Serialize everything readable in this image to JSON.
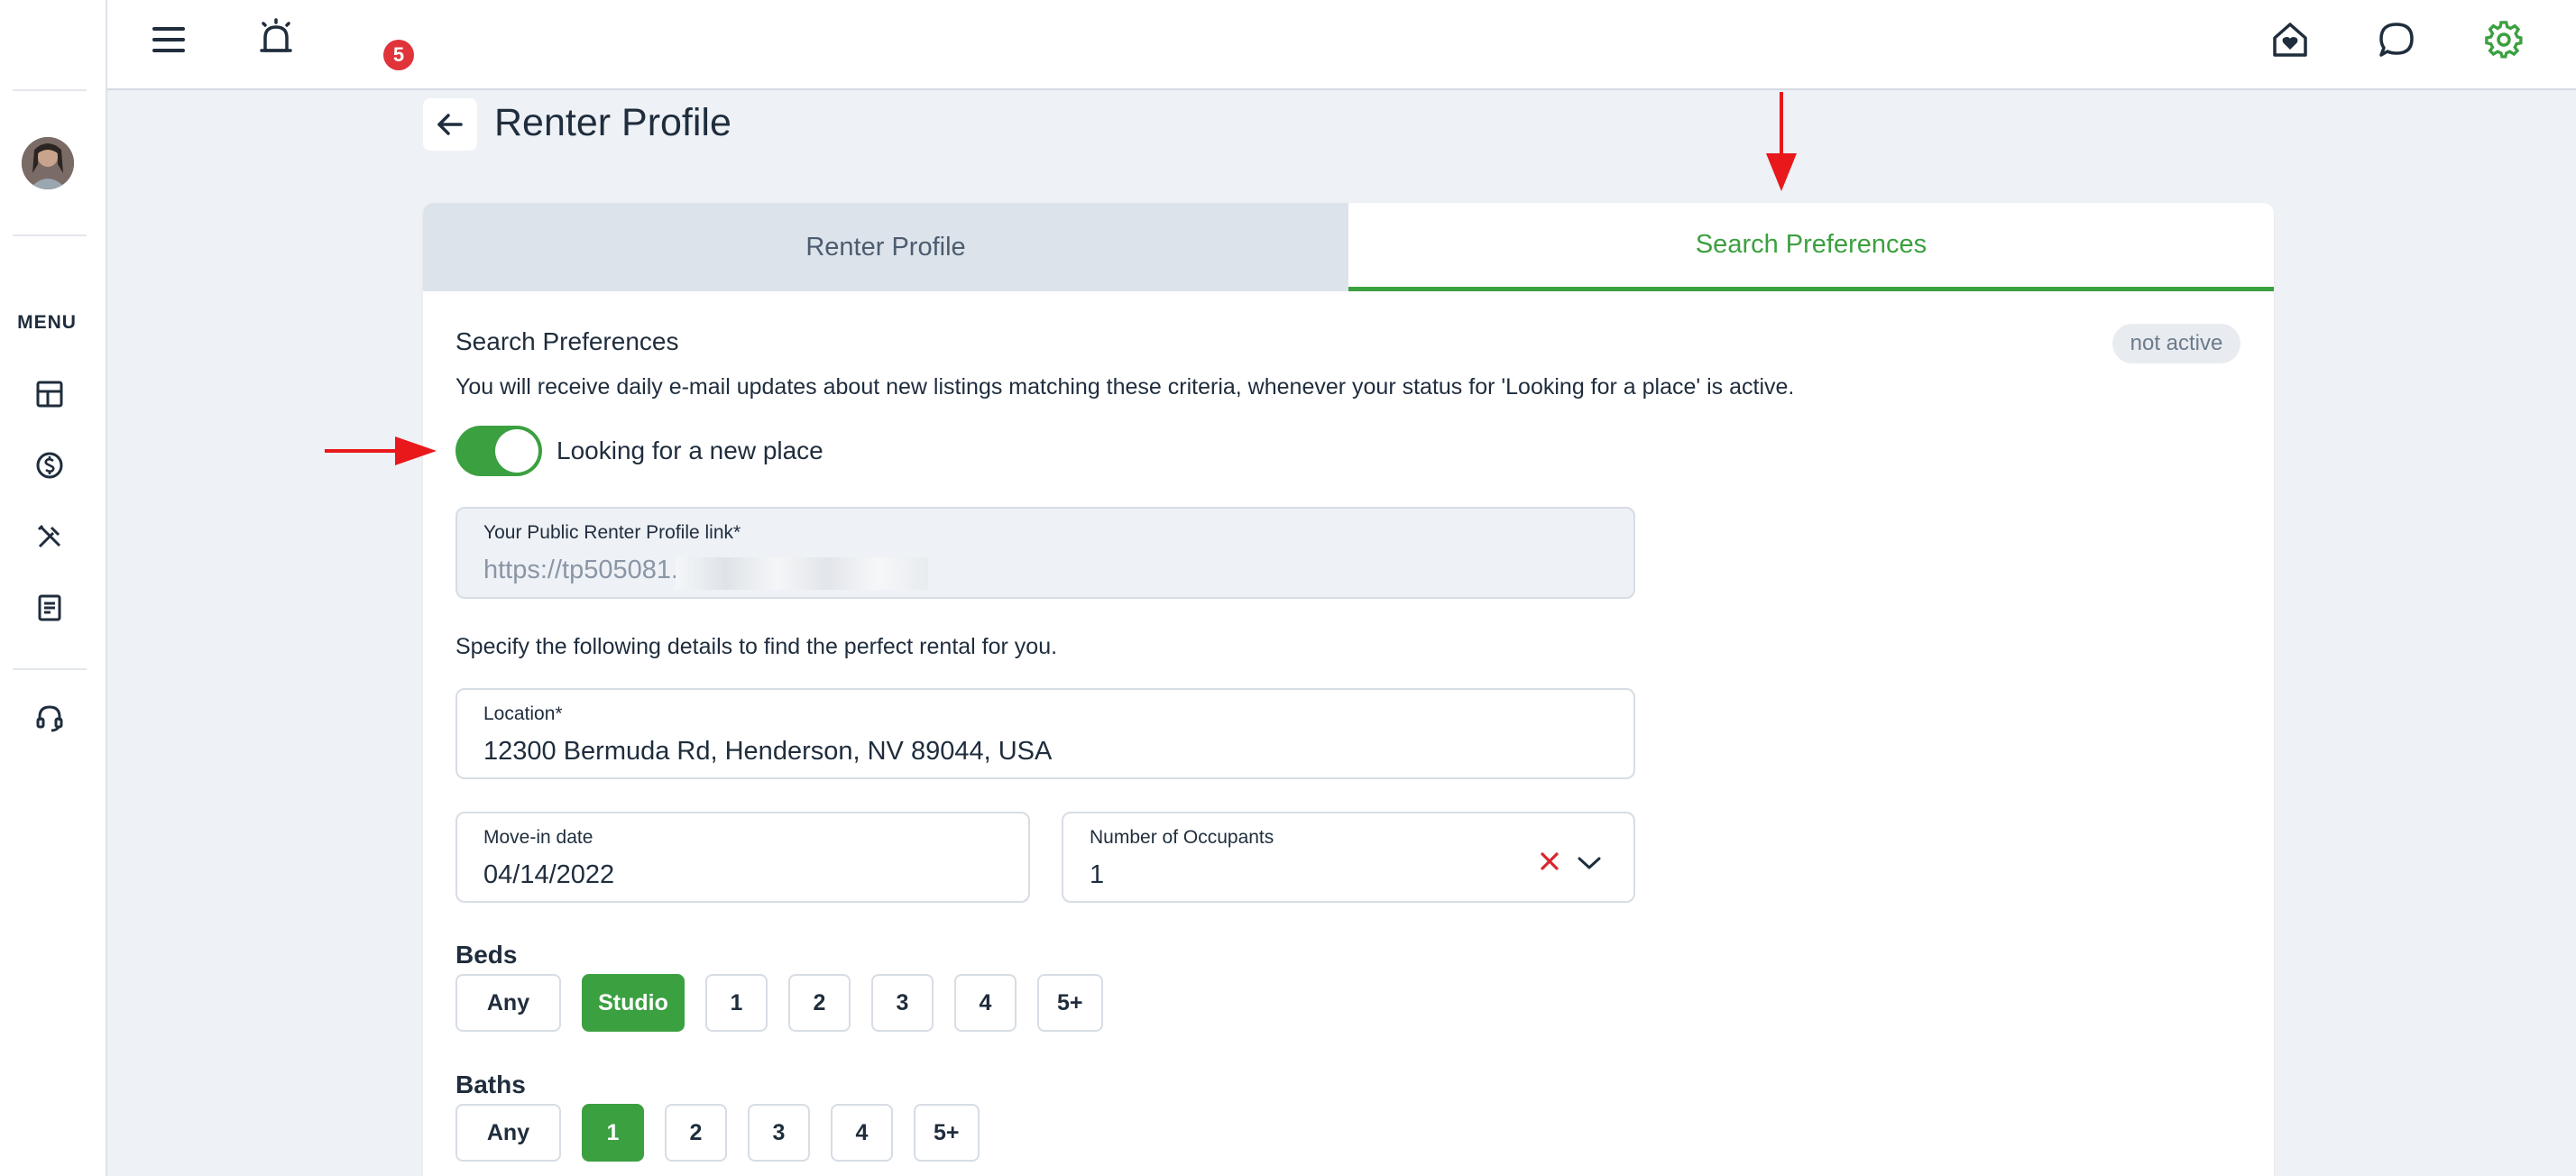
{
  "topbar": {
    "menu_icon": "hamburger-icon",
    "notifications_icon": "alarm-bell-icon",
    "notification_count": "5",
    "home_icon": "home-heart-icon",
    "chat_icon": "chat-bubble-icon",
    "settings_icon": "gear-icon"
  },
  "sidebar": {
    "menu_label": "MENU",
    "items": [
      {
        "icon": "dashboard-icon"
      },
      {
        "icon": "dollar-icon"
      },
      {
        "icon": "tools-icon"
      },
      {
        "icon": "document-icon"
      },
      {
        "icon": "headset-icon"
      }
    ]
  },
  "header": {
    "back_icon": "arrow-left-icon",
    "title": "Renter Profile"
  },
  "tabs": [
    {
      "label": "Renter Profile",
      "active": false
    },
    {
      "label": "Search Preferences",
      "active": true
    }
  ],
  "search_prefs": {
    "title": "Search Preferences",
    "status": "not active",
    "description": "You will receive daily e-mail updates about new listings matching these criteria, whenever your status for 'Looking for a place' is active.",
    "toggle_label": "Looking for a new place",
    "toggle_on": true,
    "public_link_label": "Your Public Renter Profile link*",
    "public_link_value": "https://tp505081.",
    "specify_text": "Specify the following details to find the perfect rental for you.",
    "location_label": "Location*",
    "location_value": "12300 Bermuda Rd, Henderson, NV 89044, USA",
    "movein_label": "Move-in date",
    "movein_value": "04/14/2022",
    "occupants_label": "Number of Occupants",
    "occupants_value": "1",
    "beds_label": "Beds",
    "beds_options": [
      "Any",
      "Studio",
      "1",
      "2",
      "3",
      "4",
      "5+"
    ],
    "beds_selected": "Studio",
    "baths_label": "Baths",
    "baths_options": [
      "Any",
      "1",
      "2",
      "3",
      "4",
      "5+"
    ],
    "baths_selected": "1"
  },
  "colors": {
    "accent_green": "#3ba040",
    "badge_red": "#e0333a",
    "annotation_red": "#e8181b"
  }
}
